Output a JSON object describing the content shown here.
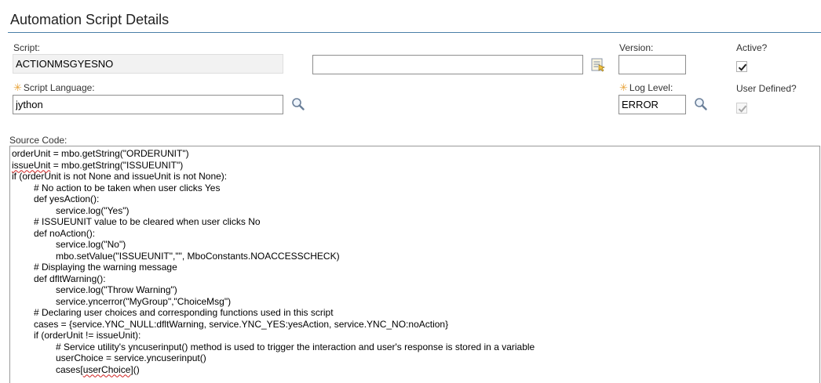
{
  "page": {
    "title": "Automation Script Details"
  },
  "script": {
    "label": "Script:",
    "value": "ACTIONMSGYESNO",
    "description_value": ""
  },
  "version": {
    "label": "Version:",
    "value": ""
  },
  "active": {
    "label": "Active?",
    "checked": true
  },
  "script_language": {
    "label": "Script Language:",
    "value": "jython",
    "required_marker": "✳"
  },
  "log_level": {
    "label": "Log Level:",
    "value": "ERROR",
    "required_marker": "✳"
  },
  "user_defined": {
    "label": "User Defined?",
    "checked": true,
    "disabled": true
  },
  "source_code": {
    "label": "Source Code:",
    "lines": [
      "orderUnit = mbo.getString(\"ORDERUNIT\")",
      "issueUnit = mbo.getString(\"ISSUEUNIT\")",
      "if (orderUnit is not None and issueUnit is not None):",
      "# No action to be taken when user clicks Yes",
      "def yesAction():",
      "service.log(\"Yes\")",
      "# ISSUEUNIT value to be cleared when user clicks No",
      "def noAction():",
      "service.log(\"No\")",
      "mbo.setValue(\"ISSUEUNIT\",\"\", MboConstants.NOACCESSCHECK)",
      "# Displaying the warning message",
      "def dfltWarning():",
      "service.log(\"Throw Warning\")",
      "service.yncerror(\"MyGroup\",\"ChoiceMsg\")",
      "# Declaring user choices and corresponding functions used in this script",
      "cases = {service.YNC_NULL:dfltWarning, service.YNC_YES:yesAction, service.YNC_NO:noAction}",
      "if (orderUnit != issueUnit):",
      "# Service utility's yncuserinput() method is used to trigger the interaction and user's response is stored in a variable",
      "userChoice = service.yncuserinput()",
      "cases[userChoice]()"
    ],
    "indent": [
      0,
      0,
      0,
      1,
      1,
      2,
      1,
      1,
      2,
      2,
      1,
      1,
      2,
      2,
      1,
      1,
      1,
      2,
      2,
      2
    ]
  },
  "icons": {
    "detail_menu": "detail-menu-icon",
    "lookup": "magnifier-icon",
    "check": "checkmark-icon"
  },
  "colors": {
    "title_rule": "#4a7fa8",
    "required": "#e8a33a",
    "readonly_bg": "#f2f2f2"
  }
}
